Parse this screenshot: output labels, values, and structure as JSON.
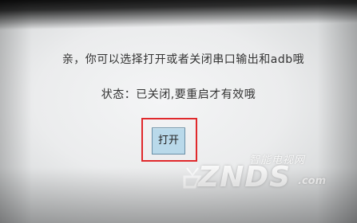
{
  "dialog": {
    "prompt_text": "亲，你可以选择打开或者关闭串口输出和adb哦",
    "status_text": "状态：已关闭,要重启才有效哦",
    "open_button_label": "打开"
  },
  "watermark": {
    "tagline": "智能电视网",
    "brand": "ZNDS",
    "suffix": ".com"
  },
  "colors": {
    "highlight_border": "#e0292c",
    "button_bg": "#b9d9ea",
    "button_border": "#6a8fa6"
  },
  "icons": {
    "watermark_logo": "tv-antenna-icon"
  }
}
